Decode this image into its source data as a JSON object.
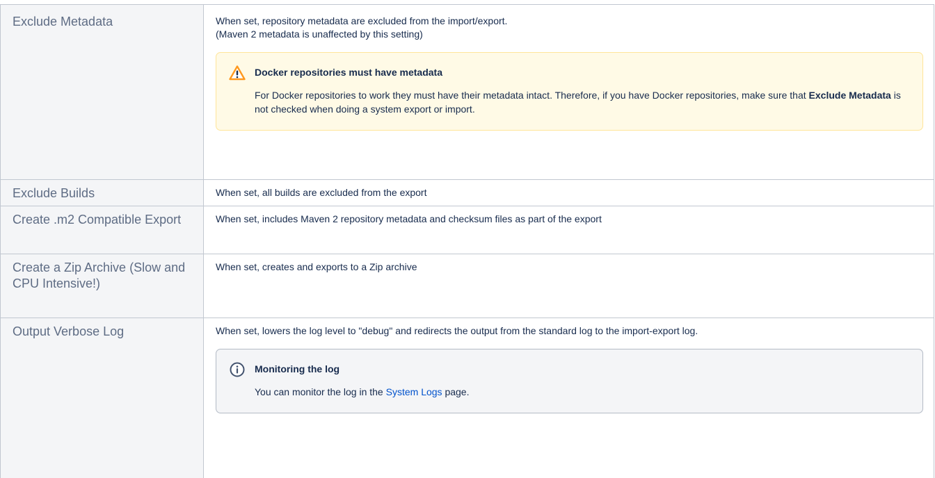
{
  "rows": [
    {
      "name": "Exclude Metadata",
      "desc_lines": [
        "When set, repository metadata are excluded from the import/export.",
        "(Maven 2 metadata is unaffected by this setting)"
      ],
      "panel": {
        "type": "warning",
        "icon": "warning-icon",
        "title": "Docker repositories must have metadata",
        "text_before": "For Docker repositories to work they must have their metadata intact. Therefore, if you have Docker repositories, make sure that ",
        "strong": "Exclude Metadata",
        "text_after": " is not checked when doing a system export or import."
      }
    },
    {
      "name": "Exclude Builds",
      "desc": "When set, all builds are excluded from the export"
    },
    {
      "name": "Create .m2 Compatible Export",
      "desc": "When set, includes Maven 2 repository metadata and checksum files as part of the export"
    },
    {
      "name": "Create a Zip Archive (Slow and CPU Intensive!)",
      "desc": "When set, creates and exports to a Zip archive"
    },
    {
      "name": "Output Verbose Log",
      "desc": "When set, lowers the log level to \"debug\" and redirects the output from the standard log to the import-export log.",
      "panel": {
        "type": "info",
        "icon": "info-icon",
        "title": "Monitoring the log",
        "text_before": "You can monitor the log in the ",
        "link": "System Logs",
        "text_after": " page."
      }
    }
  ],
  "colors": {
    "warning_bg": "#fffae6",
    "warning_icon": "#ff991f",
    "info_bg": "#f4f5f7",
    "link": "#0052cc"
  }
}
